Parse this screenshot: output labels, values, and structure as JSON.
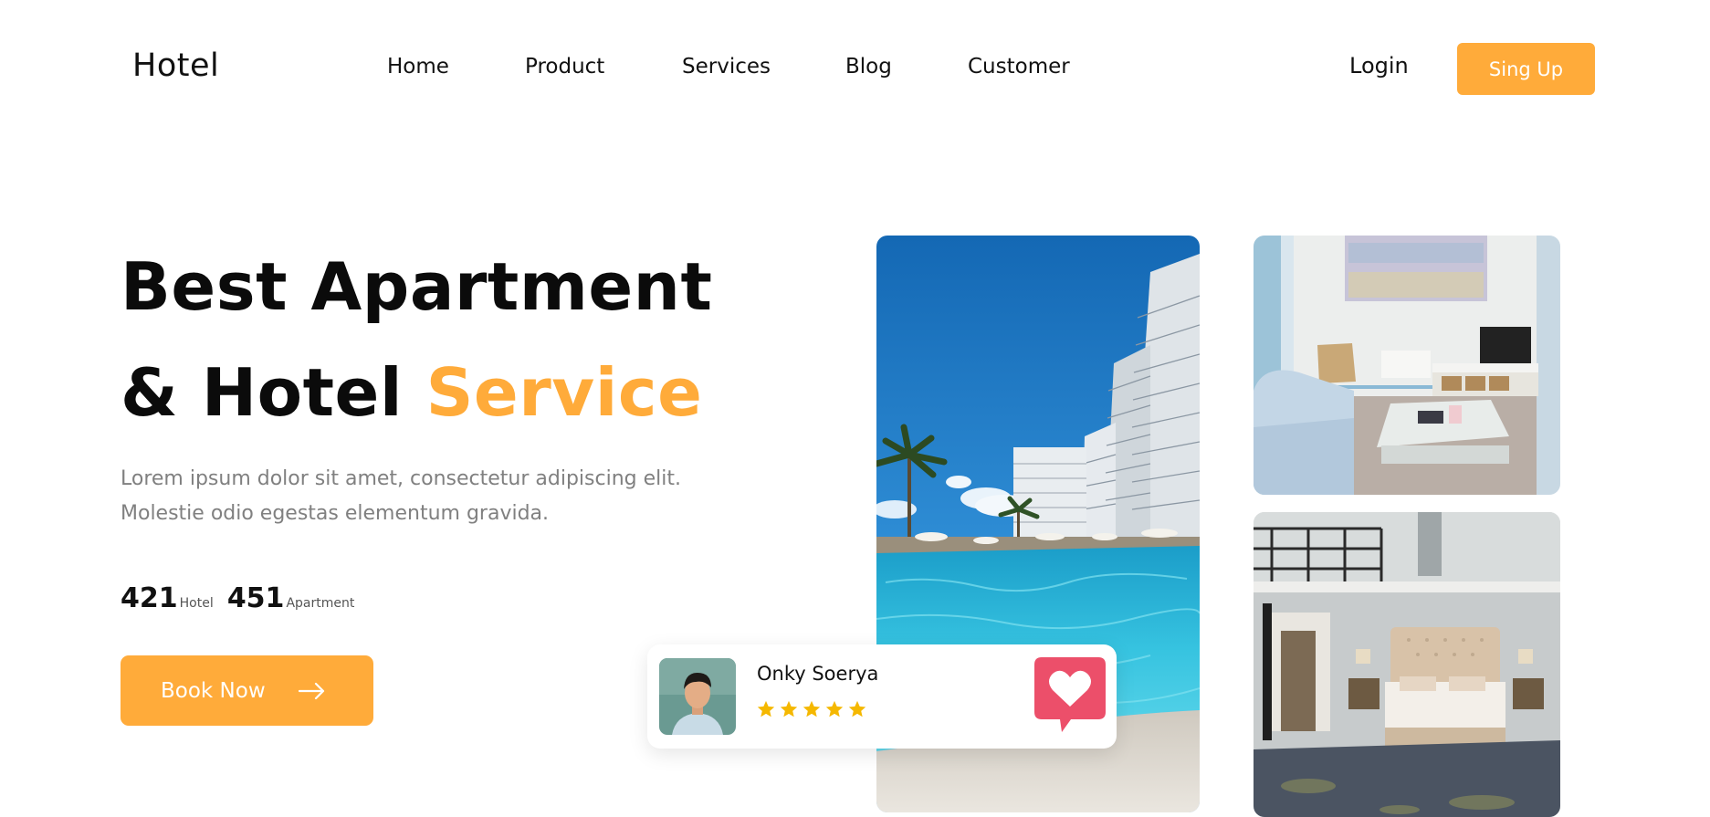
{
  "brand": {
    "logo": "Hotel"
  },
  "nav": {
    "items": [
      {
        "label": "Home"
      },
      {
        "label": "Product"
      },
      {
        "label": "Services"
      },
      {
        "label": "Blog"
      },
      {
        "label": "Customer"
      }
    ],
    "login_label": "Login",
    "signup_label": "Sing Up"
  },
  "hero": {
    "headline_line1": "Best Apartment",
    "headline_line2_prefix": "& Hotel ",
    "headline_line2_accent": "Service",
    "description_line1": "Lorem ipsum dolor sit amet, consectetur adipiscing elit.",
    "description_line2": "Molestie odio egestas elementum gravida.",
    "stats": [
      {
        "value": "421",
        "label": "Hotel"
      },
      {
        "value": "451",
        "label": "Apartment"
      }
    ],
    "cta_label": "Book Now"
  },
  "review": {
    "name": "Onky Soerya",
    "rating": 5,
    "rating_max": 5,
    "icons": [
      "avatar",
      "star-icon",
      "heart-chat-icon"
    ]
  },
  "images": [
    "pool-photo",
    "living-room-photo",
    "bedroom-photo"
  ],
  "colors": {
    "accent": "#ffab3a",
    "star": "#f5b800",
    "heart_badge": "#ec4f6a",
    "text_dark": "#0b0b0b",
    "text_muted": "#808080"
  },
  "icons": {
    "cta": "arrow-right-icon"
  }
}
